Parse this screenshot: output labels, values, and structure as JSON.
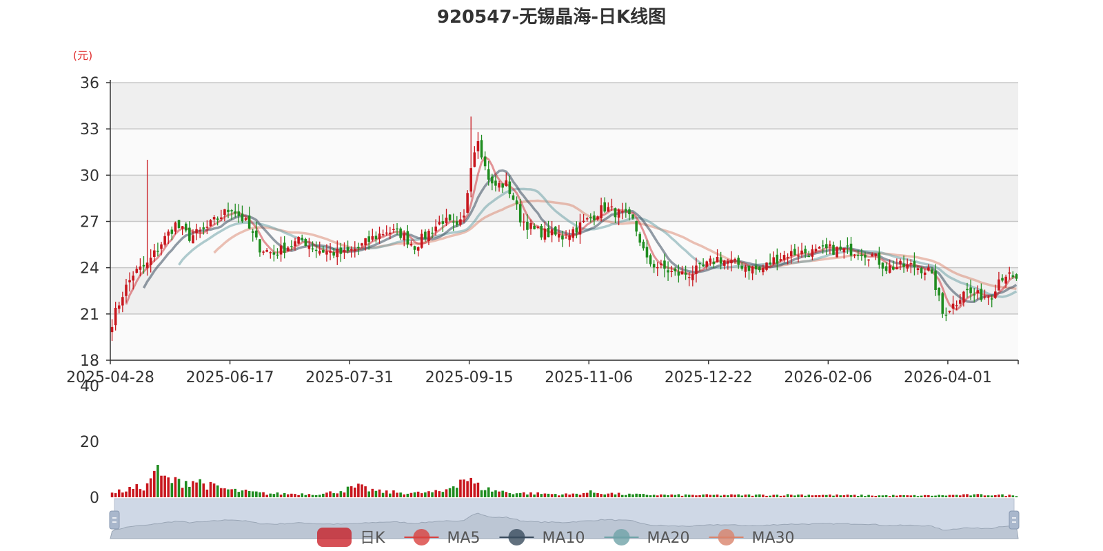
{
  "chart_data": [
    {
      "type": "candlestick",
      "title": "920547-无锡晶海-日K线图",
      "y_unit": "(元)",
      "ylim": [
        18,
        36
      ],
      "y_ticks": [
        "18",
        "21",
        "24",
        "27",
        "30",
        "33",
        "36"
      ],
      "x_ticks": [
        "2025-04-28",
        "2025-06-17",
        "2025-07-31",
        "2025-09-15",
        "2025-11-06",
        "2025-12-22",
        "2026-02-06",
        "2026-04-01"
      ],
      "x_tick_indices": [
        0,
        34,
        68,
        102,
        136,
        170,
        204,
        238
      ],
      "total_days": 258,
      "grid": true,
      "band_colors": [
        "#efefef",
        "#fafafa"
      ],
      "legend_position": "bottom",
      "colors": {
        "up": "#c8161d",
        "down": "#1f8c1f",
        "ma5": "#c8161d",
        "ma10": "#3a4c5e",
        "ma20": "#6fa3a8",
        "ma30": "#d9836b"
      },
      "series": [
        {
          "name": "日K",
          "swatch": "#c8161d"
        },
        {
          "name": "MA5",
          "swatch": "#d9413f"
        },
        {
          "name": "MA10",
          "swatch": "#3a4c5e"
        },
        {
          "name": "MA20",
          "swatch": "#6fa3a8"
        },
        {
          "name": "MA30",
          "swatch": "#d9836b"
        }
      ],
      "price_keypoints": [
        [
          0,
          20.5
        ],
        [
          3,
          22.3
        ],
        [
          6,
          23.6
        ],
        [
          10,
          24.2
        ],
        [
          14,
          25.6
        ],
        [
          18,
          26.8
        ],
        [
          22,
          26.0
        ],
        [
          26,
          26.4
        ],
        [
          30,
          27.2
        ],
        [
          34,
          27.9
        ],
        [
          38,
          26.9
        ],
        [
          42,
          25.3
        ],
        [
          46,
          24.9
        ],
        [
          50,
          25.4
        ],
        [
          54,
          25.8
        ],
        [
          58,
          25.2
        ],
        [
          62,
          25.0
        ],
        [
          66,
          24.9
        ],
        [
          70,
          25.3
        ],
        [
          74,
          25.9
        ],
        [
          78,
          26.4
        ],
        [
          82,
          26.2
        ],
        [
          86,
          25.4
        ],
        [
          90,
          26.3
        ],
        [
          94,
          27.1
        ],
        [
          98,
          26.5
        ],
        [
          100,
          27.2
        ],
        [
          102,
          30.8
        ],
        [
          104,
          32.5
        ],
        [
          106,
          30.5
        ],
        [
          108,
          29.3
        ],
        [
          112,
          29.4
        ],
        [
          114,
          28.5
        ],
        [
          116,
          27.2
        ],
        [
          120,
          26.4
        ],
        [
          124,
          26.2
        ],
        [
          128,
          26.0
        ],
        [
          132,
          26.6
        ],
        [
          136,
          27.2
        ],
        [
          138,
          27.6
        ],
        [
          140,
          27.9
        ],
        [
          144,
          27.5
        ],
        [
          146,
          27.3
        ],
        [
          148,
          27.0
        ],
        [
          150,
          25.8
        ],
        [
          152,
          24.4
        ],
        [
          156,
          24.0
        ],
        [
          160,
          23.6
        ],
        [
          164,
          23.6
        ],
        [
          168,
          24.0
        ],
        [
          172,
          24.6
        ],
        [
          176,
          24.3
        ],
        [
          180,
          24.1
        ],
        [
          184,
          23.8
        ],
        [
          188,
          24.5
        ],
        [
          192,
          24.9
        ],
        [
          196,
          25.0
        ],
        [
          200,
          25.0
        ],
        [
          204,
          25.2
        ],
        [
          208,
          25.1
        ],
        [
          212,
          25.1
        ],
        [
          216,
          24.8
        ],
        [
          220,
          24.0
        ],
        [
          224,
          24.1
        ],
        [
          228,
          24.1
        ],
        [
          232,
          23.8
        ],
        [
          234,
          22.8
        ],
        [
          236,
          21.0
        ],
        [
          238,
          21.4
        ],
        [
          240,
          21.8
        ],
        [
          242,
          22.6
        ],
        [
          244,
          22.3
        ],
        [
          246,
          22.2
        ],
        [
          248,
          22.2
        ],
        [
          250,
          22.3
        ],
        [
          252,
          23.3
        ],
        [
          254,
          23.6
        ],
        [
          256,
          23.2
        ],
        [
          258,
          23.0
        ]
      ],
      "candles": [
        [
          33,
          30,
          34,
          28.5
        ],
        [
          33,
          31.2,
          33.4,
          29.8
        ],
        [
          31.2,
          32.2,
          32.6,
          30.6
        ]
      ],
      "big_wicks": [
        [
          10,
          31.0
        ],
        [
          102,
          33.8
        ]
      ]
    },
    {
      "type": "bar",
      "title": "",
      "ylim": [
        0,
        40
      ],
      "y_ticks": [
        "0",
        "20",
        "40"
      ],
      "volume_keypoints": [
        [
          0,
          1.5
        ],
        [
          6,
          3.2
        ],
        [
          10,
          4.0
        ],
        [
          12,
          10.5
        ],
        [
          14,
          7.0
        ],
        [
          18,
          5.5
        ],
        [
          24,
          6.0
        ],
        [
          28,
          4.0
        ],
        [
          34,
          2.5
        ],
        [
          44,
          1.3
        ],
        [
          60,
          1.2
        ],
        [
          70,
          3.6
        ],
        [
          76,
          2.0
        ],
        [
          86,
          1.5
        ],
        [
          94,
          2.0
        ],
        [
          100,
          7.2
        ],
        [
          104,
          4.0
        ],
        [
          108,
          2.5
        ],
        [
          114,
          1.6
        ],
        [
          130,
          1.0
        ],
        [
          136,
          1.8
        ],
        [
          146,
          1.0
        ],
        [
          160,
          0.8
        ],
        [
          180,
          0.8
        ],
        [
          196,
          0.9
        ],
        [
          210,
          0.7
        ],
        [
          230,
          0.6
        ],
        [
          240,
          0.8
        ],
        [
          250,
          0.9
        ],
        [
          258,
          0.6
        ]
      ]
    }
  ]
}
